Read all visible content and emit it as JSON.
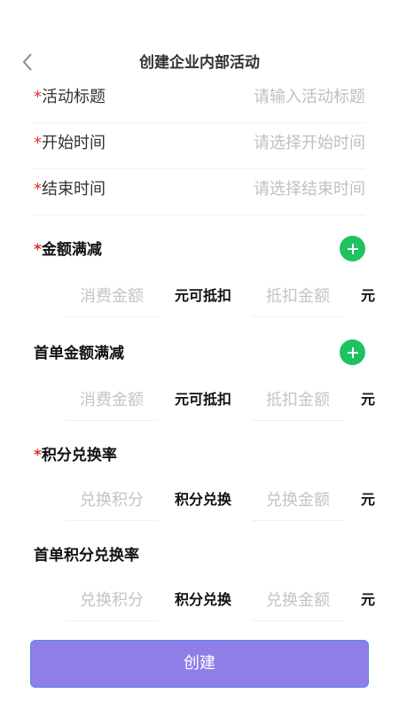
{
  "header": {
    "title": "创建企业内部活动",
    "back_icon": "chevron-left-icon"
  },
  "required_mark": "*",
  "fields": [
    {
      "label": "活动标题",
      "placeholder": "请输入活动标题",
      "value": ""
    },
    {
      "label": "开始时间",
      "placeholder": "请选择开始时间",
      "value": ""
    },
    {
      "label": "结束时间",
      "placeholder": "请选择结束时间",
      "value": ""
    }
  ],
  "sections": [
    {
      "title": "金额满减",
      "required": true,
      "add_icon": "plus-circle-icon",
      "input1_placeholder": "消费金额",
      "connector": "元可抵扣",
      "input2_placeholder": "抵扣金额",
      "unit": "元"
    },
    {
      "title": "首单金额满减",
      "required": false,
      "add_icon": "plus-circle-icon",
      "input1_placeholder": "消费金额",
      "connector": "元可抵扣",
      "input2_placeholder": "抵扣金额",
      "unit": "元"
    },
    {
      "title": "积分兑换率",
      "required": true,
      "input1_placeholder": "兑换积分",
      "connector": "积分兑换",
      "input2_placeholder": "兑换金额",
      "unit": "元"
    },
    {
      "title": "首单积分兑换率",
      "required": false,
      "input1_placeholder": "兑换积分",
      "connector": "积分兑换",
      "input2_placeholder": "兑换金额",
      "unit": "元"
    }
  ],
  "create_button": {
    "label": "创建"
  },
  "colors": {
    "accent": "#8e7fe8",
    "add_button": "#1ec25f",
    "required": "#e0302a",
    "placeholder": "#c0c0c0"
  }
}
